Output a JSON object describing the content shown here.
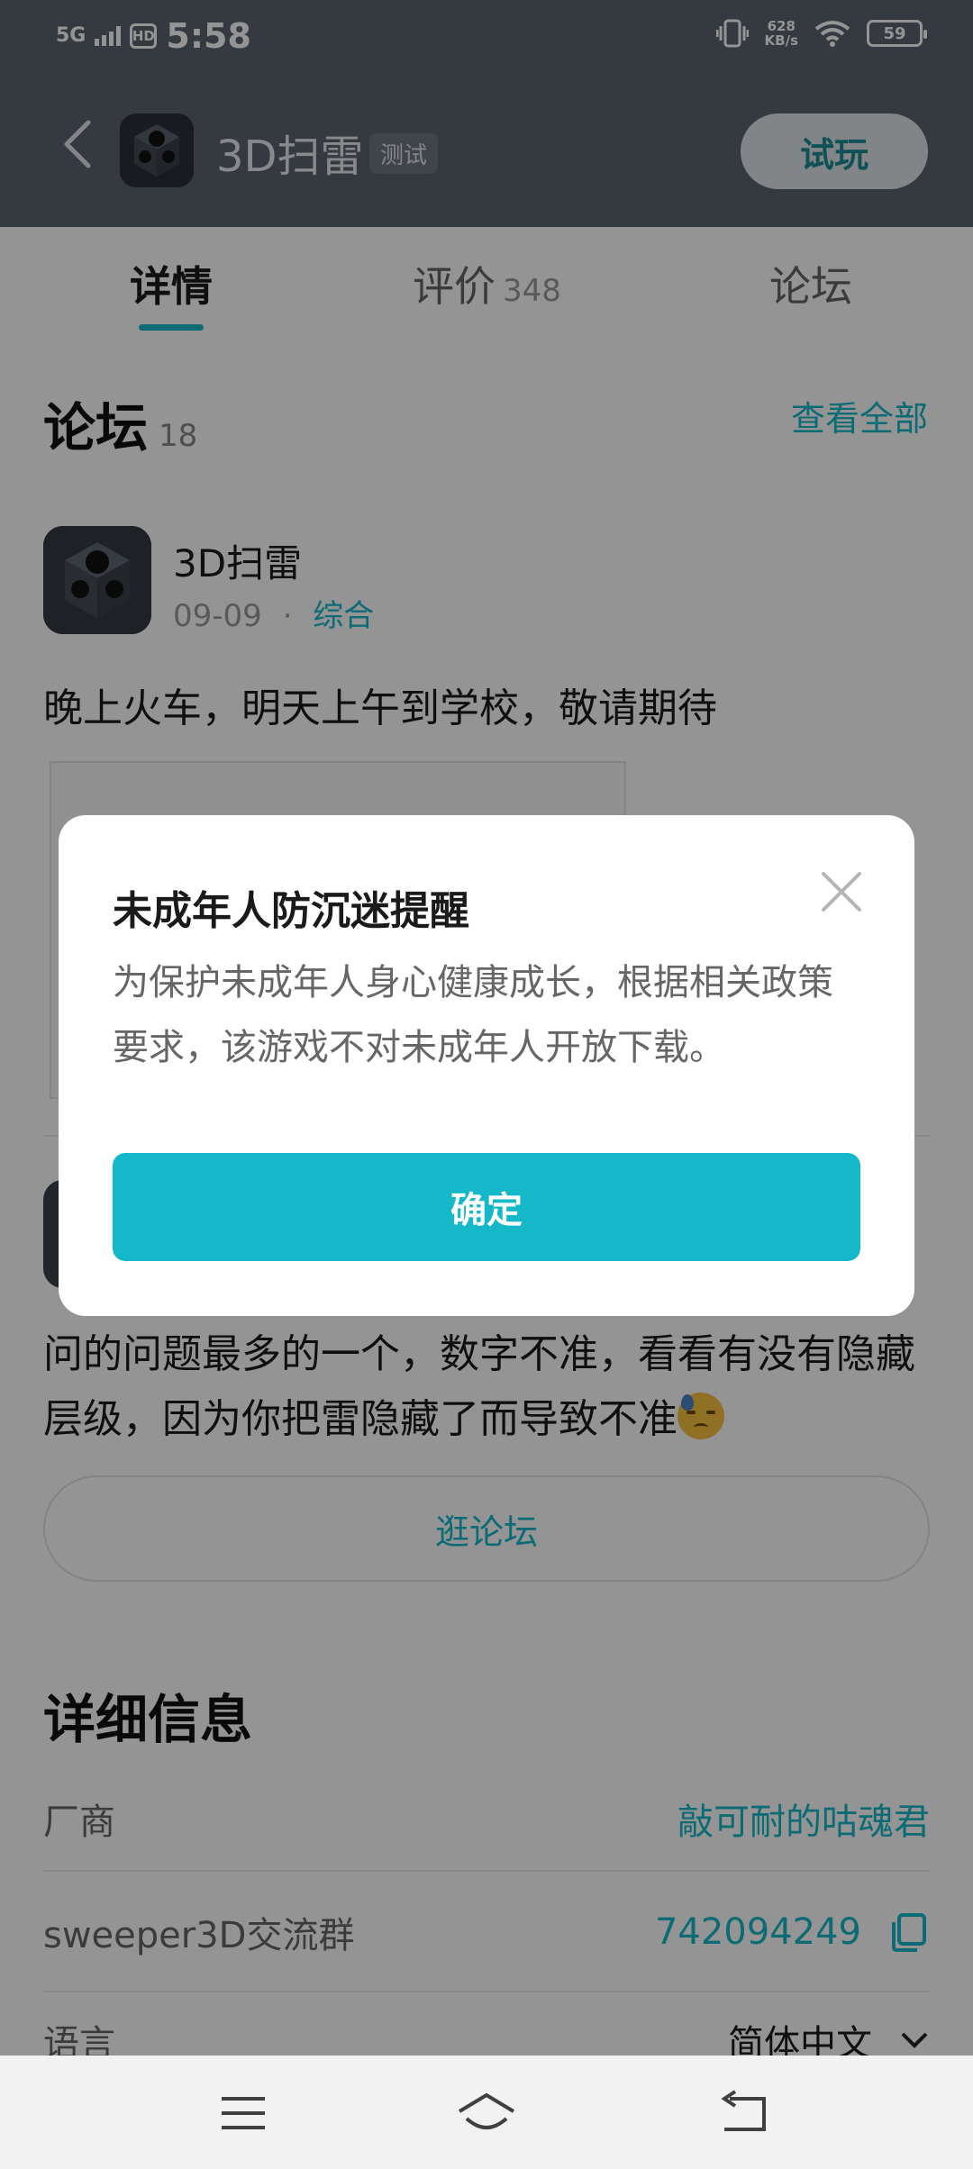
{
  "status_bar": {
    "network": "5G",
    "hd": "HD",
    "time": "5:58",
    "speed_value": "628",
    "speed_unit": "KB/s",
    "battery": "59"
  },
  "header": {
    "app_title": "3D扫雷",
    "badge": "测试",
    "try_button": "试玩"
  },
  "tabs": [
    {
      "label": "详情",
      "count": "",
      "active": true
    },
    {
      "label": "评价",
      "count": "348",
      "active": false
    },
    {
      "label": "论坛",
      "count": "",
      "active": false
    }
  ],
  "forum": {
    "title": "论坛",
    "count": "18",
    "view_all": "查看全部",
    "post1": {
      "author": "3D扫雷",
      "date": "09-09",
      "dot": "·",
      "category": "综合",
      "text": "晚上火车，明天上午到学校，敬请期待"
    },
    "post2": {
      "text": "问的问题最多的一个，数字不准，看看有没有隐藏层级，因为你把雷隐藏了而导致不准"
    },
    "browse_button": "逛论坛"
  },
  "details": {
    "title": "详细信息",
    "rows": [
      {
        "key": "厂商",
        "value": "敲可耐的咕魂君"
      },
      {
        "key": "sweeper3D交流群",
        "value": "742094249"
      },
      {
        "key": "语言",
        "value": "简体中文"
      }
    ]
  },
  "dialog": {
    "title": "未成年人防沉迷提醒",
    "body": "为保护未成年人身心健康成长，根据相关政策要求，该游戏不对未成年人开放下载。",
    "confirm": "确定"
  },
  "icons": {
    "back": "back-arrow-icon",
    "close": "close-icon",
    "copy": "copy-icon",
    "chevron": "chevron-down-icon",
    "menu": "menu-icon",
    "home": "home-icon",
    "return": "return-icon"
  },
  "colors": {
    "accent": "#15b8c9",
    "header": "#5a646f",
    "overlay": "rgba(0,0,0,0.42)"
  }
}
